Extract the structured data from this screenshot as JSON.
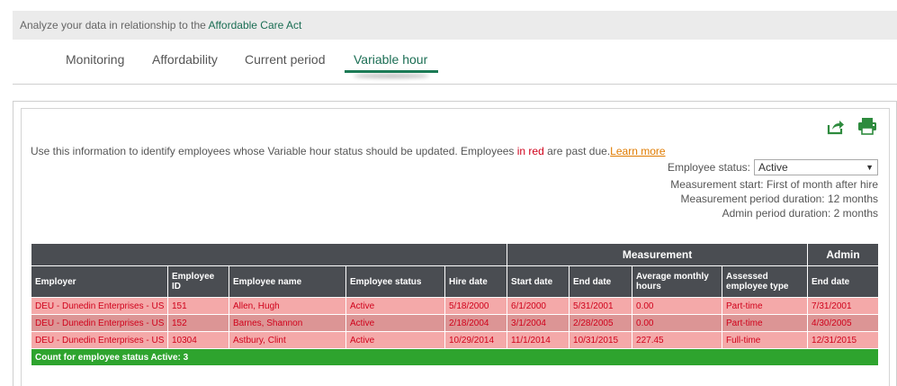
{
  "banner": {
    "text": "Analyze your data in relationship to the ",
    "link": "Affordable Care Act"
  },
  "tabs": [
    {
      "label": "Monitoring",
      "active": false
    },
    {
      "label": "Affordability",
      "active": false
    },
    {
      "label": "Current period",
      "active": false
    },
    {
      "label": "Variable hour",
      "active": true
    }
  ],
  "toolbar": {
    "export_icon": "share-export-icon",
    "print_icon": "printer-icon",
    "icon_color": "#2e8b3e"
  },
  "intro": {
    "text_before": "Use this information to identify employees whose Variable hour status should be updated. Employees ",
    "red_text": "in red",
    "text_after": " are past due.",
    "learn_more": "Learn more"
  },
  "filters": {
    "status_label": "Employee status:",
    "status_value": "Active",
    "measurement_start": "Measurement start: First of month after hire",
    "measurement_duration": "Measurement period duration: 12 months",
    "admin_duration": "Admin period duration: 2 months"
  },
  "table": {
    "group_headers": {
      "measurement": "Measurement",
      "admin": "Admin"
    },
    "columns": [
      "Employer",
      "Employee ID",
      "Employee name",
      "Employee status",
      "Hire date",
      "Start date",
      "End date",
      "Average monthly hours",
      "Assessed employee type",
      "End date"
    ],
    "rows": [
      [
        "DEU - Dunedin Enterprises - US",
        "151",
        "Allen, Hugh",
        "Active",
        "5/18/2000",
        "6/1/2000",
        "5/31/2001",
        "0.00",
        "Part-time",
        "7/31/2001"
      ],
      [
        "DEU - Dunedin Enterprises - US",
        "152",
        "Barnes, Shannon",
        "Active",
        "2/18/2004",
        "3/1/2004",
        "2/28/2005",
        "0.00",
        "Part-time",
        "4/30/2005"
      ],
      [
        "DEU - Dunedin Enterprises - US",
        "10304",
        "Astbury, Clint",
        "Active",
        "10/29/2014",
        "11/1/2014",
        "10/31/2015",
        "227.45",
        "Full-time",
        "12/31/2015"
      ]
    ],
    "count_label": "Count for employee status Active: 3"
  },
  "colors": {
    "accent": "#1b7a55",
    "overdue_text": "#d0021b",
    "row_light": "#f4a9a9",
    "row_dark": "#dc9595",
    "count_bar": "#2ea42e",
    "header_bg": "#4a4d52"
  }
}
